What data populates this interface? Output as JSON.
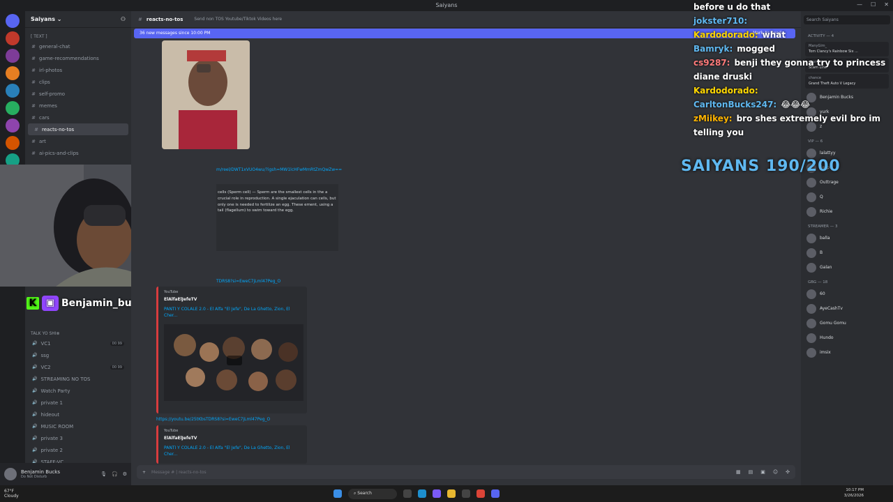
{
  "window": {
    "title": "Saiyans"
  },
  "server": {
    "name": "Saiyans"
  },
  "channels_text": [
    {
      "label": "general-chat"
    },
    {
      "label": "game-recommendations"
    },
    {
      "label": "irl-photos"
    },
    {
      "label": "clips"
    },
    {
      "label": "self-promo"
    },
    {
      "label": "memes"
    },
    {
      "label": "cars"
    },
    {
      "label": "reacts-no-tos",
      "active": true
    },
    {
      "label": "art"
    },
    {
      "label": "ai-pics-and-clips"
    }
  ],
  "category_text": "[ Text ]",
  "voice_category": "TALK YO SHI⊗",
  "voice_channels": [
    {
      "label": "VC1",
      "tag": "00 99"
    },
    {
      "label": "ssg"
    },
    {
      "label": "VC2",
      "tag": "00 99"
    },
    {
      "label": "STREAMING NO TOS"
    },
    {
      "label": "Watch Party"
    },
    {
      "label": "private 1"
    },
    {
      "label": "hideout"
    },
    {
      "label": "MUSIC ROOM"
    },
    {
      "label": "private 3"
    },
    {
      "label": "private 2"
    },
    {
      "label": "STAFF-VC"
    }
  ],
  "user": {
    "name": "Benjamin Bucks",
    "status": "Do Not Disturb"
  },
  "channel": {
    "name": "reacts-no-tos",
    "topic": "Send non TOS Youtube/Tiktok Videos here"
  },
  "new_messages": {
    "text": "36 new messages since 10:00 PM",
    "mark": "Mark As Read"
  },
  "messages": {
    "reel_link": "m/reel/DWT1xVUO4wu/?igsh=MW1lcHFwMmRtZmQwZw==",
    "sperm_text": "cells (Sperm cell) — Sperm are the smallest cells in the a crucial role in reproduction. A single ejaculation can cells, but only one is needed to fertilize an egg. These ement, using a tail (flagellum) to swim toward the egg.",
    "yt_link_partial": "TDRS8?si=EweC7jLml47Peg_O",
    "yt_link": "https://youtu.be/25tKbsTDRS8?si=EweC7jLml47Peg_O",
    "embed1": {
      "provider": "YouTube",
      "author": "ElAlfaElJefeTV",
      "title": "PANTI Y COLALE 2.0 - El Alfa \"El Jefe\", De La Ghetto, Zion, El Cher..."
    },
    "embed2": {
      "provider": "YouTube",
      "author": "ElAlfaElJefeTV",
      "title": "PANTI Y COLALE 2.0 - El Alfa \"El Jefe\", De La Ghetto, Zion, El Cher..."
    }
  },
  "composer": {
    "placeholder": "Message # | reacts-no-tos"
  },
  "members": {
    "search_placeholder": "Search Saiyans",
    "activity_header": "Activity — 4",
    "activities": [
      {
        "who": "ManyGim_",
        "what": "Tom Clancy's Rainbow Six ..."
      },
      {
        "who": "chance",
        "what": "Scam Line"
      },
      {
        "who": "chance",
        "what": "Grand Theft Auto V Legacy"
      }
    ],
    "sections": [
      {
        "title": "",
        "items": [
          "Benjamin Bucks",
          "yurk",
          "z"
        ]
      },
      {
        "title": "VIP — 6",
        "items": [
          "lalattyy",
          "jiesp9",
          "Outtrage",
          "Q",
          "Richie"
        ]
      },
      {
        "title": "Streamer — 3",
        "items": [
          "balla",
          "B",
          "Galan"
        ]
      },
      {
        "title": "GBG — 18",
        "items": [
          "60",
          "AyeCashTv",
          "Gomu Gomu",
          "Hundo",
          "imsix"
        ]
      }
    ]
  },
  "overlay": {
    "chat": [
      {
        "user": "",
        "msg": "before u do that",
        "color": "#ffffff"
      },
      {
        "user": "jokster710:",
        "msg": "",
        "color": "#5fb8f0"
      },
      {
        "user": "Kardodorado:",
        "msg": "what",
        "color": "#ffd700"
      },
      {
        "user": "Bamryk:",
        "msg": "mogged",
        "color": "#5fb8f0"
      },
      {
        "user": "cs9287:",
        "msg": "benji they gonna try to princess diane druski",
        "color": "#ff7a7a"
      },
      {
        "user": "Kardodorado:",
        "msg": "",
        "color": "#ffd700"
      },
      {
        "user": "CarltonBucks247:",
        "msg": "😂😂😂",
        "color": "#5fb8f0"
      },
      {
        "user": "zMiikey:",
        "msg": "bro shes extremely evil bro im telling you",
        "color": "#ffb400"
      }
    ],
    "goal": "SAIYANS 190/200",
    "streamer": "Benjamin_bucks"
  },
  "taskbar": {
    "weather_temp": "67°F",
    "weather_desc": "Cloudy",
    "search": "Search",
    "time": "10:17 PM",
    "date": "3/26/2026"
  }
}
